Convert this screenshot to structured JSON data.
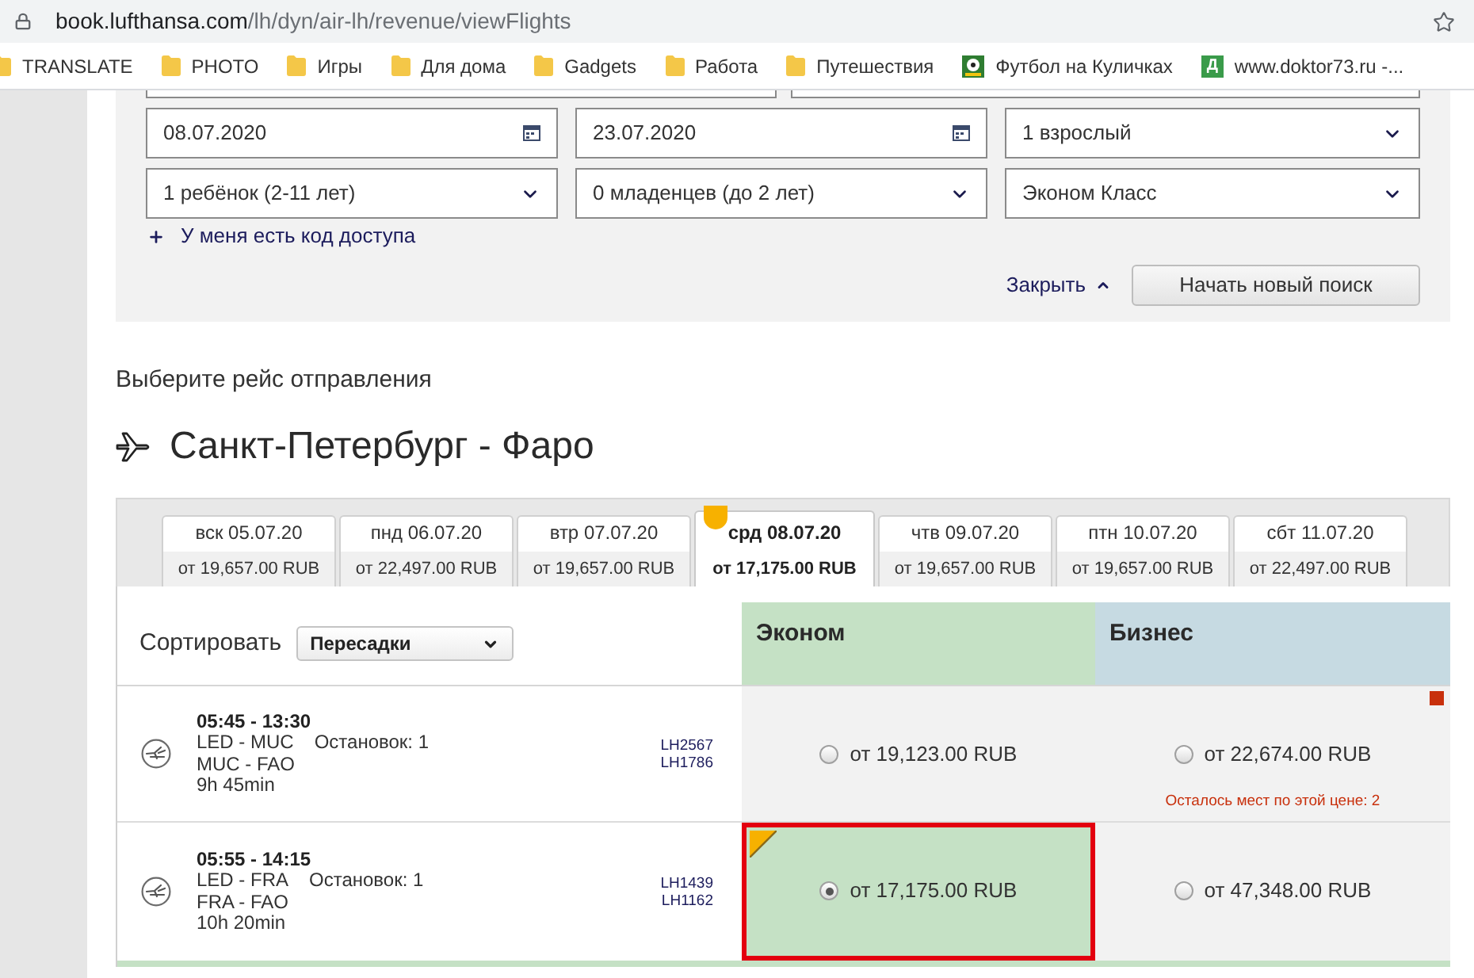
{
  "browser": {
    "url_host": "book.lufthansa.com",
    "url_path": "/lh/dyn/air-lh/revenue/viewFlights",
    "bookmarks": [
      {
        "kind": "folder",
        "label": "TRANSLATE"
      },
      {
        "kind": "folder",
        "label": "PHOTO"
      },
      {
        "kind": "folder",
        "label": "Игры"
      },
      {
        "kind": "folder",
        "label": "Для дома"
      },
      {
        "kind": "folder",
        "label": "Gadgets"
      },
      {
        "kind": "folder",
        "label": "Работа"
      },
      {
        "kind": "folder",
        "label": "Путешествия"
      },
      {
        "kind": "ball",
        "label": "Футбол на Куличках"
      },
      {
        "kind": "letter",
        "icon_text": "Д",
        "label": "www.doktor73.ru -..."
      }
    ]
  },
  "search_form": {
    "fields": [
      {
        "kind": "date",
        "value": "08.07.2020"
      },
      {
        "kind": "date",
        "value": "23.07.2020"
      },
      {
        "kind": "select",
        "value": "1 взрослый"
      },
      {
        "kind": "select",
        "value": "1 ребёнок (2-11 лет)"
      },
      {
        "kind": "select",
        "value": "0 младенцев (до 2 лет)"
      },
      {
        "kind": "select",
        "value": "Эконом Класс"
      }
    ],
    "access_code_link": "У меня есть код доступа",
    "close_link": "Закрыть",
    "new_search_button": "Начать новый поиск"
  },
  "heading": "Выберите рейс отправления",
  "route": "Санкт-Петербург - Фаро",
  "date_tabs": [
    {
      "day": "вск 05.07.20",
      "price": "от 19,657.00 RUB",
      "selected": false
    },
    {
      "day": "пнд 06.07.20",
      "price": "от 22,497.00 RUB",
      "selected": false
    },
    {
      "day": "втр 07.07.20",
      "price": "от 19,657.00 RUB",
      "selected": false
    },
    {
      "day": "срд 08.07.20",
      "price": "от 17,175.00 RUB",
      "selected": true
    },
    {
      "day": "чтв 09.07.20",
      "price": "от 19,657.00 RUB",
      "selected": false
    },
    {
      "day": "птн 10.07.20",
      "price": "от 19,657.00 RUB",
      "selected": false
    },
    {
      "day": "сбт 11.07.20",
      "price": "от 22,497.00 RUB",
      "selected": false
    }
  ],
  "results": {
    "sort_label": "Сортировать",
    "sort_value": "Пересадки",
    "fare_columns": [
      {
        "label": "Эконом",
        "color": "#c5e1c5"
      },
      {
        "label": "Бизнес",
        "color": "#c6dae2"
      }
    ],
    "flights": [
      {
        "times": "05:45 - 13:30",
        "legs": [
          "LED - MUC",
          "MUC - FAO"
        ],
        "stops": "Остановок: 1",
        "duration": "9h 45min",
        "flight_numbers": [
          "LH2567",
          "LH1786"
        ],
        "fares": [
          {
            "price": "от 19,123.00 RUB",
            "selected": false,
            "flagged": false
          },
          {
            "price": "от 22,674.00 RUB",
            "selected": false,
            "flagged": true,
            "note": "Осталось мест по этой цене: 2"
          }
        ]
      },
      {
        "times": "05:55 - 14:15",
        "legs": [
          "LED - FRA",
          "FRA - FAO"
        ],
        "stops": "Остановок: 1",
        "duration": "10h 20min",
        "flight_numbers": [
          "LH1439",
          "LH1162"
        ],
        "fares": [
          {
            "price": "от 17,175.00 RUB",
            "selected": true,
            "flagged": false
          },
          {
            "price": "от 47,348.00 RUB",
            "selected": false,
            "flagged": false
          }
        ]
      }
    ]
  }
}
